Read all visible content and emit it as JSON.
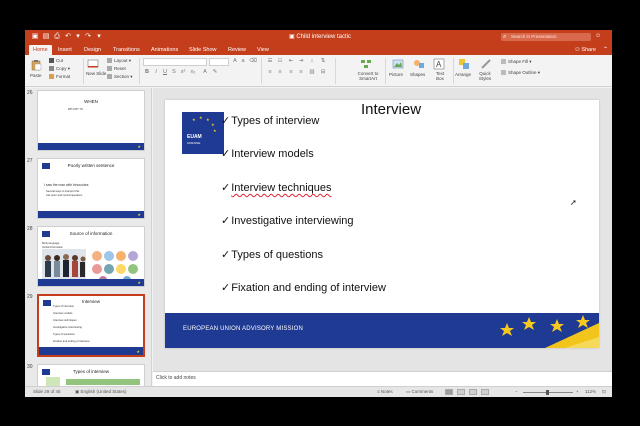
{
  "titlebar": {
    "doc_title": "Child interview tactic",
    "search_placeholder": "Search in Presentation",
    "bg_color": "#c43e1c"
  },
  "tabs": [
    {
      "label": "Home",
      "active": true
    },
    {
      "label": "Insert"
    },
    {
      "label": "Design"
    },
    {
      "label": "Transitions"
    },
    {
      "label": "Animations"
    },
    {
      "label": "Slide Show"
    },
    {
      "label": "Review"
    },
    {
      "label": "View"
    }
  ],
  "share_label": "Share",
  "ribbon": {
    "paste": "Paste",
    "cut": "Cut",
    "copy": "Copy",
    "format": "Format",
    "new_slide": "New Slide",
    "layout": "Layout",
    "reset": "Reset",
    "section": "Section",
    "convert_smartart": "Convert to SmartArt",
    "picture": "Picture",
    "shapes": "Shapes",
    "text_box": "Text Box",
    "arrange": "Arrange",
    "quick_styles": "Quick Styles",
    "shape_fill": "Shape Fill",
    "shape_outline": "Shape Outline"
  },
  "thumbnails": [
    {
      "num": "26",
      "title": "WHEN",
      "lines": [
        "WITH BY TO"
      ]
    },
    {
      "num": "27",
      "title": "Poorly written sentence",
      "lines": [
        "I saw the man with binoculars",
        "Several ways to interpret this",
        "Ask open and neutral questions"
      ]
    },
    {
      "num": "28",
      "title": "Source of information",
      "lines": [
        "Body language",
        "Verbal information"
      ]
    },
    {
      "num": "29",
      "title": "Interview",
      "lines": [
        "Types of interview",
        "Interview models",
        "Interview techniques",
        "Investigative interviewing",
        "Types of questions",
        "Fixation and ending of interview"
      ]
    },
    {
      "num": "30",
      "title": "Types of interview",
      "lines": []
    }
  ],
  "slide": {
    "title": "Interview",
    "logo_text": "EUAM",
    "logo_sub": "UKRAINE",
    "check": "✓",
    "bullets": [
      "Types of interview",
      "Interview models",
      "Interview techniques",
      "Investigative interviewing",
      "Types of questions",
      "Fixation and ending of interview"
    ],
    "footer": "EUROPEAN UNION ADVISORY MISSION",
    "brand_blue": "#1f3a93",
    "star_yellow": "#f7c81e"
  },
  "notes_placeholder": "Click to add notes",
  "status": {
    "slide_count": "Slide 29 of 45",
    "language": "English (United States)",
    "notes": "Notes",
    "comments": "Comments",
    "zoom": "112%"
  }
}
